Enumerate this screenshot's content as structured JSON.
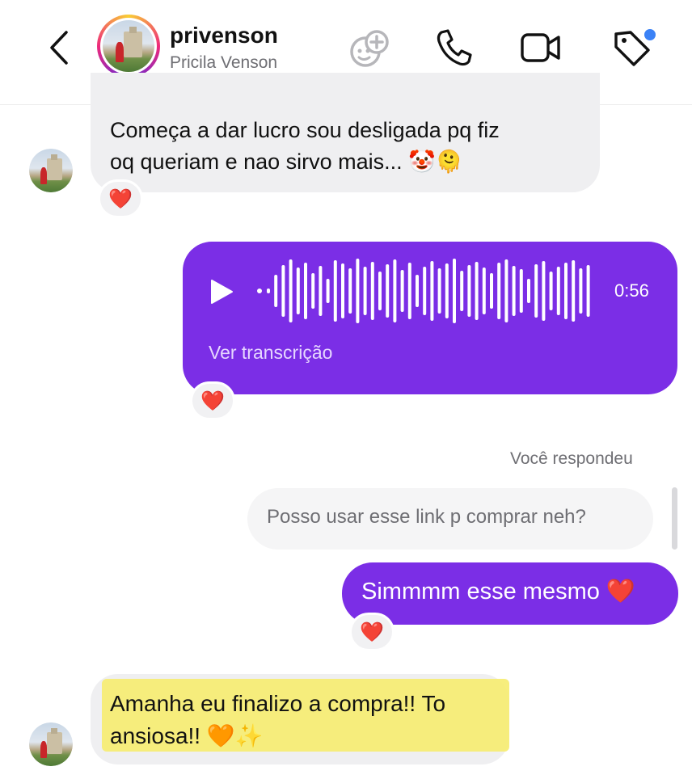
{
  "header": {
    "username": "privenson",
    "full_name": "Pricila Venson",
    "icons": [
      "chevron-left-icon",
      "game-controller-icon",
      "phone-icon",
      "video-camera-icon",
      "tag-icon"
    ],
    "notification_dot_color": "#3b82f6"
  },
  "messages": [
    {
      "type": "incoming",
      "lines": [
        "Começa a dar lucro sou desligada pq fiz",
        "oq queriam e nao sirvo mais... 🤡🫠"
      ],
      "reaction": "❤️"
    },
    {
      "type": "outgoing_voice",
      "duration": "0:56",
      "transcript_link": "Ver transcrição",
      "reaction": "❤️"
    },
    {
      "type": "reply_context",
      "label": "Você respondeu",
      "quoted": "Posso usar esse link p comprar neh?"
    },
    {
      "type": "outgoing",
      "text": "Simmmm esse mesmo ❤️",
      "reaction": "❤️"
    },
    {
      "type": "incoming",
      "text": "Amanha eu finalizo a compra!! To ansiosa!! 🧡✨"
    }
  ],
  "colors": {
    "outgoing_bubble": "#7b2ee6",
    "incoming_bubble": "#efeff1",
    "highlight": "#f6ec6f"
  }
}
